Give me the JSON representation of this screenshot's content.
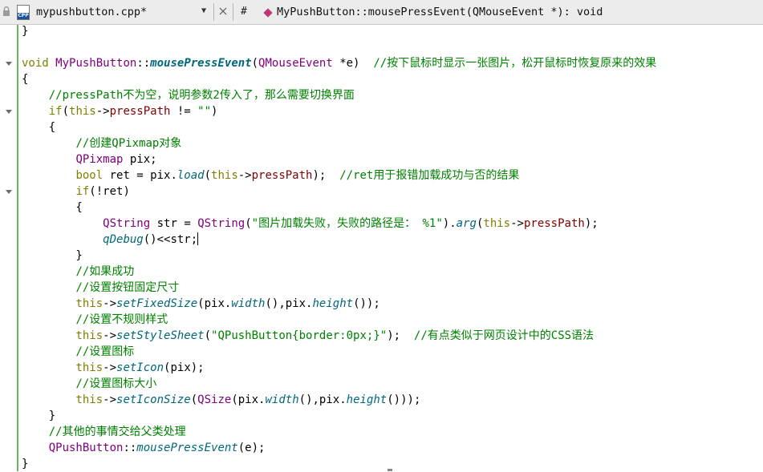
{
  "tabbar": {
    "filename": "mypushbutton.cpp*",
    "file_icon_label": "CPP",
    "hash": "#",
    "symbol": "MyPushButton::mousePressEvent(QMouseEvent *): void"
  },
  "colors": {
    "keyword": "#7f7f00",
    "class": "#800080",
    "function": "#00677c",
    "member": "#800000",
    "string": "#008000",
    "comment": "#008000",
    "number": "#000080",
    "change_bar": "#69b55f"
  },
  "code_lines": [
    [
      [
        "}",
        "plain"
      ]
    ],
    [],
    [
      [
        "void",
        "kw"
      ],
      [
        " ",
        "plain"
      ],
      [
        "MyPushButton",
        "cls"
      ],
      [
        "::",
        "plain"
      ],
      [
        "mousePressEvent",
        "fnit"
      ],
      [
        "(",
        "plain"
      ],
      [
        "QMouseEvent",
        "cls"
      ],
      [
        " *e)  ",
        "plain"
      ],
      [
        "//按下鼠标时显示一张图片，松开鼠标时恢复原来的效果",
        "cmt"
      ]
    ],
    [
      [
        "{",
        "plain"
      ]
    ],
    [
      [
        "    ",
        "plain"
      ],
      [
        "//pressPath不为空，说明参数2传入了，那么需要切换界面",
        "cmt"
      ]
    ],
    [
      [
        "    ",
        "plain"
      ],
      [
        "if",
        "kw"
      ],
      [
        "(",
        "plain"
      ],
      [
        "this",
        "kw"
      ],
      [
        "->",
        "plain"
      ],
      [
        "pressPath",
        "mem"
      ],
      [
        " != ",
        "plain"
      ],
      [
        "\"\"",
        "str"
      ],
      [
        ")",
        "plain"
      ]
    ],
    [
      [
        "    {",
        "plain"
      ]
    ],
    [
      [
        "        ",
        "plain"
      ],
      [
        "//创建QPixmap对象",
        "cmt"
      ]
    ],
    [
      [
        "        ",
        "plain"
      ],
      [
        "QPixmap",
        "cls"
      ],
      [
        " pix;",
        "plain"
      ]
    ],
    [
      [
        "        ",
        "plain"
      ],
      [
        "bool",
        "kw"
      ],
      [
        " ret = pix.",
        "plain"
      ],
      [
        "load",
        "fnv"
      ],
      [
        "(",
        "plain"
      ],
      [
        "this",
        "kw"
      ],
      [
        "->",
        "plain"
      ],
      [
        "pressPath",
        "mem"
      ],
      [
        ");  ",
        "plain"
      ],
      [
        "//ret用于报错加载成功与否的结果",
        "cmt"
      ]
    ],
    [
      [
        "        ",
        "plain"
      ],
      [
        "if",
        "kw"
      ],
      [
        "(!ret)",
        "plain"
      ]
    ],
    [
      [
        "        {",
        "plain"
      ]
    ],
    [
      [
        "            ",
        "plain"
      ],
      [
        "QString",
        "cls"
      ],
      [
        " str = ",
        "plain"
      ],
      [
        "QString",
        "cls"
      ],
      [
        "(",
        "plain"
      ],
      [
        "\"图片加载失败，失败的路径是： %1\"",
        "str"
      ],
      [
        ").",
        "plain"
      ],
      [
        "arg",
        "fnv"
      ],
      [
        "(",
        "plain"
      ],
      [
        "this",
        "kw"
      ],
      [
        "->",
        "plain"
      ],
      [
        "pressPath",
        "mem"
      ],
      [
        ");",
        "plain"
      ]
    ],
    [
      [
        "            ",
        "plain"
      ],
      [
        "qDebug",
        "fnv"
      ],
      [
        "()<<str;",
        "plain"
      ],
      [
        "",
        "caret"
      ]
    ],
    [
      [
        "        }",
        "plain"
      ]
    ],
    [
      [
        "        ",
        "plain"
      ],
      [
        "//如果成功",
        "cmt"
      ]
    ],
    [
      [
        "        ",
        "plain"
      ],
      [
        "//设置按钮固定尺寸",
        "cmt"
      ]
    ],
    [
      [
        "        ",
        "plain"
      ],
      [
        "this",
        "kw"
      ],
      [
        "->",
        "plain"
      ],
      [
        "setFixedSize",
        "fnv"
      ],
      [
        "(pix.",
        "plain"
      ],
      [
        "width",
        "fnv"
      ],
      [
        "(),pix.",
        "plain"
      ],
      [
        "height",
        "fnv"
      ],
      [
        "());",
        "plain"
      ]
    ],
    [
      [
        "        ",
        "plain"
      ],
      [
        "//设置不规则样式",
        "cmt"
      ]
    ],
    [
      [
        "        ",
        "plain"
      ],
      [
        "this",
        "kw"
      ],
      [
        "->",
        "plain"
      ],
      [
        "setStyleSheet",
        "fnv"
      ],
      [
        "(",
        "plain"
      ],
      [
        "\"QPushButton{border:0px;}\"",
        "str"
      ],
      [
        ");  ",
        "plain"
      ],
      [
        "//有点类似于网页设计中的CSS语法",
        "cmt"
      ]
    ],
    [
      [
        "        ",
        "plain"
      ],
      [
        "//设置图标",
        "cmt"
      ]
    ],
    [
      [
        "        ",
        "plain"
      ],
      [
        "this",
        "kw"
      ],
      [
        "->",
        "plain"
      ],
      [
        "setIcon",
        "fnv"
      ],
      [
        "(pix);",
        "plain"
      ]
    ],
    [
      [
        "        ",
        "plain"
      ],
      [
        "//设置图标大小",
        "cmt"
      ]
    ],
    [
      [
        "        ",
        "plain"
      ],
      [
        "this",
        "kw"
      ],
      [
        "->",
        "plain"
      ],
      [
        "setIconSize",
        "fnv"
      ],
      [
        "(",
        "plain"
      ],
      [
        "QSize",
        "cls"
      ],
      [
        "(pix.",
        "plain"
      ],
      [
        "width",
        "fnv"
      ],
      [
        "(),pix.",
        "plain"
      ],
      [
        "height",
        "fnv"
      ],
      [
        "()));",
        "plain"
      ]
    ],
    [
      [
        "    }",
        "plain"
      ]
    ],
    [
      [
        "    ",
        "plain"
      ],
      [
        "//其他的事情交给父类处理",
        "cmt"
      ]
    ],
    [
      [
        "    ",
        "plain"
      ],
      [
        "QPushButton",
        "cls"
      ],
      [
        "::",
        "plain"
      ],
      [
        "mousePressEvent",
        "fnv"
      ],
      [
        "(e);",
        "plain"
      ]
    ],
    [
      [
        "}",
        "plain"
      ]
    ]
  ],
  "fold_marker_lines": [
    2,
    5,
    10
  ]
}
